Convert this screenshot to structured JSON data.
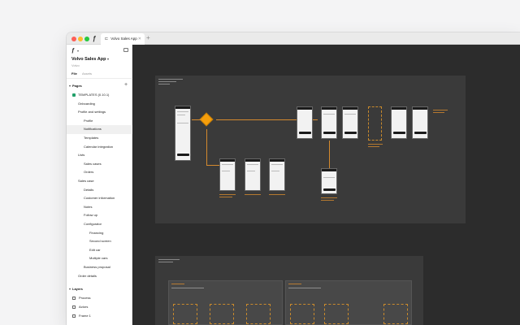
{
  "window": {
    "tab_title": "Volvo Sales App",
    "tab_icon": "figma-file-icon"
  },
  "sidebar": {
    "file_title": "Volvo Sales App",
    "file_subtitle": "Volvo",
    "tabs": [
      "File",
      "Assets"
    ],
    "pages_label": "Pages",
    "pages": [
      {
        "label": "TEMPLATES (0.10.1)",
        "indent": 0,
        "checked": true
      },
      {
        "label": "Onboarding",
        "indent": 1
      },
      {
        "label": "Profile and settings",
        "indent": 1
      },
      {
        "label": "Profile",
        "indent": 2
      },
      {
        "label": "Notifications",
        "indent": 2,
        "selected": true
      },
      {
        "label": "Templates",
        "indent": 2
      },
      {
        "label": "Calendar integration",
        "indent": 2
      },
      {
        "label": "Lists",
        "indent": 1
      },
      {
        "label": "Sales cases",
        "indent": 2
      },
      {
        "label": "Orders",
        "indent": 2
      },
      {
        "label": "Sales case",
        "indent": 1
      },
      {
        "label": "Details",
        "indent": 2
      },
      {
        "label": "Customer information",
        "indent": 2
      },
      {
        "label": "Notes",
        "indent": 2
      },
      {
        "label": "Follow up",
        "indent": 2
      },
      {
        "label": "Configurator",
        "indent": 2
      },
      {
        "label": "Financing",
        "indent": 3
      },
      {
        "label": "Second screen",
        "indent": 3
      },
      {
        "label": "Edit car",
        "indent": 3
      },
      {
        "label": "Multiple cars",
        "indent": 3
      },
      {
        "label": "Business proposal",
        "indent": 2
      },
      {
        "label": "Order details",
        "indent": 1
      }
    ],
    "layers_label": "Layers",
    "layers": [
      {
        "label": "Process"
      },
      {
        "label": "Actors"
      },
      {
        "label": "Frame 1"
      }
    ]
  },
  "icons": {
    "figma_logo": "figma-logo-icon",
    "panel_toggle": "sidebar-toggle-icon",
    "add_page": "plus-icon",
    "new_tab": "plus-icon"
  },
  "colors": {
    "canvas": "#2c2c2c",
    "accent_orange": "#f59e0b",
    "check_green": "#22a06b"
  }
}
